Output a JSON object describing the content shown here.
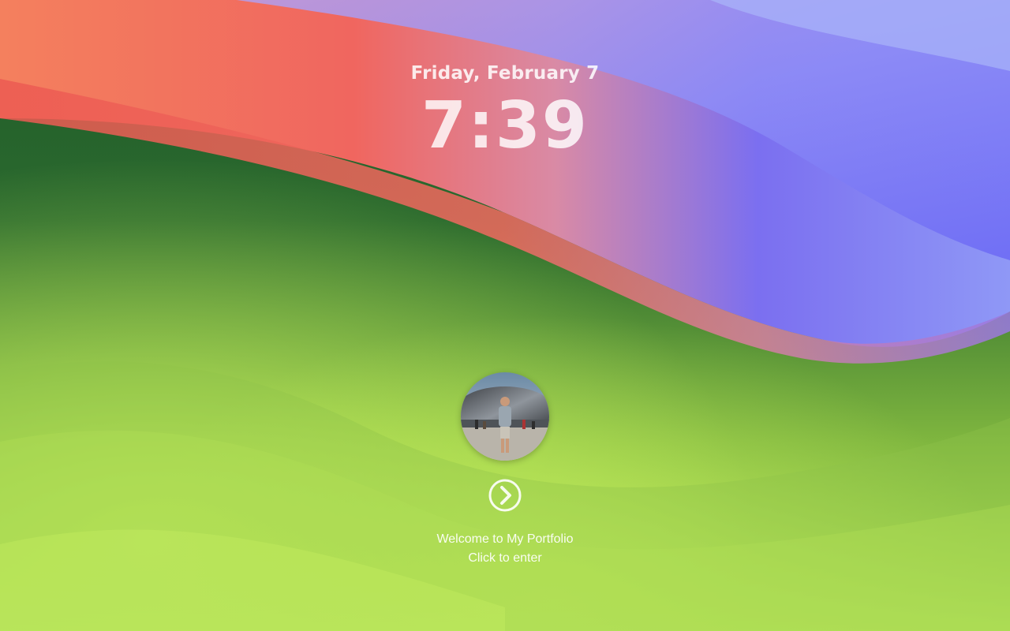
{
  "lock_screen": {
    "date": "Friday, February 7",
    "time": "7:39",
    "welcome": "Welcome to My Portfolio",
    "hint": "Click to enter",
    "enter_icon": "chevron-right-circle-icon",
    "avatar_description": "profile photo"
  },
  "colors": {
    "green_dark": "#1f5a2a",
    "green_light": "#b8e85a",
    "coral": "#f26c5e",
    "blue_violet": "#6f6cf7"
  }
}
